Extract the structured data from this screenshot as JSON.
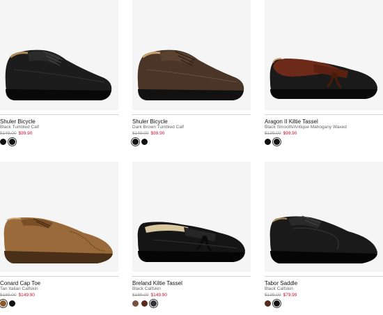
{
  "products": [
    {
      "name": "Shuler Bicycle",
      "color": "Black Tumbled Calf",
      "old_price": "$149.00",
      "sale_price": "$99.90",
      "shoe_style": "derby-black",
      "swatches": [
        {
          "color": "#111111",
          "selected": false
        },
        {
          "color": "#111111",
          "selected": true
        }
      ]
    },
    {
      "name": "Shuler Bicycle",
      "color": "Dark Brown Tumbled Calf",
      "old_price": "$149.00",
      "sale_price": "$99.90",
      "shoe_style": "derby-brown",
      "swatches": [
        {
          "color": "#111111",
          "selected": true
        },
        {
          "color": "#111111",
          "selected": false
        }
      ]
    },
    {
      "name": "Aragon II Kiltie Tassel",
      "color": "Black Smooth/Antique Mahogany Waxed",
      "old_price": "$139.00",
      "sale_price": "$99.90",
      "shoe_style": "kiltie-two-tone",
      "swatches": [
        {
          "color": "#111111",
          "selected": false
        },
        {
          "color": "#111111",
          "selected": true
        }
      ]
    },
    {
      "name": "Conard Cap Toe",
      "color": "Tan Italian Calfskin",
      "old_price": "$189.00",
      "sale_price": "$149.90",
      "shoe_style": "captoe-tan",
      "swatches": [
        {
          "color": "#8a5a2b",
          "selected": true
        },
        {
          "color": "#111111",
          "selected": false
        }
      ]
    },
    {
      "name": "Breland Kiltie Tassel",
      "color": "Black Calfskin",
      "old_price": "$189.00",
      "sale_price": "$149.90",
      "shoe_style": "kiltie-black",
      "swatches": [
        {
          "color": "#7a5040",
          "selected": false
        },
        {
          "color": "#5a2a1a",
          "selected": false
        },
        {
          "color": "#333333",
          "selected": true
        }
      ]
    },
    {
      "name": "Tabor Saddle",
      "color": "Black Calfskin",
      "old_price": "$139.00",
      "sale_price": "$79.99",
      "shoe_style": "saddle-black",
      "swatches": [
        {
          "color": "#5a2a1a",
          "selected": false
        },
        {
          "color": "#111111",
          "selected": true
        }
      ]
    }
  ]
}
